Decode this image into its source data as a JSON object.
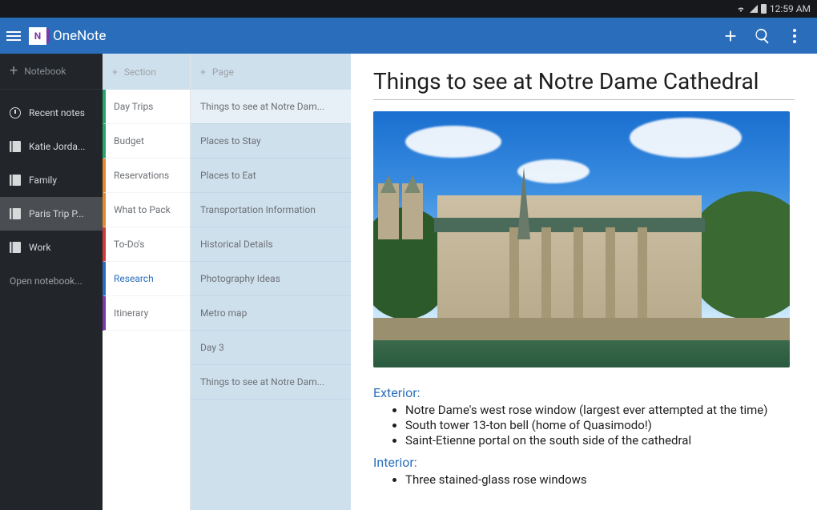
{
  "status": {
    "time": "12:59 AM"
  },
  "app": {
    "title": "OneNote"
  },
  "notebooks": {
    "add_label": "Notebook",
    "open_label": "Open notebook...",
    "items": [
      {
        "label": "Recent notes",
        "icon": "clock"
      },
      {
        "label": "Katie Jorda...",
        "icon": "book"
      },
      {
        "label": "Family",
        "icon": "book"
      },
      {
        "label": "Paris Trip P...",
        "icon": "book",
        "selected": true
      },
      {
        "label": "Work",
        "icon": "book"
      }
    ]
  },
  "sections": {
    "add_label": "Section",
    "items": [
      {
        "label": "Day Trips",
        "color": "#2aa36b"
      },
      {
        "label": "Budget",
        "color": "#2aa36b"
      },
      {
        "label": "Reservations",
        "color": "#e08a2e"
      },
      {
        "label": "What to Pack",
        "color": "#e08a2e"
      },
      {
        "label": "To-Do's",
        "color": "#d03a3a"
      },
      {
        "label": "Research",
        "color": "#2a6ebb",
        "selected": true
      },
      {
        "label": "Itinerary",
        "color": "#7a3aa5"
      }
    ]
  },
  "pages": {
    "add_label": "Page",
    "items": [
      {
        "label": "Things to see at Notre Dam...",
        "selected": true
      },
      {
        "label": "Places to Stay"
      },
      {
        "label": "Places to Eat"
      },
      {
        "label": "Transportation Information"
      },
      {
        "label": "Historical Details"
      },
      {
        "label": "Photography Ideas"
      },
      {
        "label": "Metro map"
      },
      {
        "label": "Day 3"
      },
      {
        "label": "Things to see at Notre Dam..."
      }
    ]
  },
  "page": {
    "title": "Things to see at Notre Dame Cathedral",
    "h1": "Exterior:",
    "exterior": [
      "Notre Dame's west rose window (largest ever attempted at the time)",
      "South tower 13-ton bell (home of Quasimodo!)",
      "Saint-Etienne portal on the south side of the cathedral"
    ],
    "h2": "Interior:",
    "interior": [
      "Three stained-glass rose windows"
    ]
  }
}
